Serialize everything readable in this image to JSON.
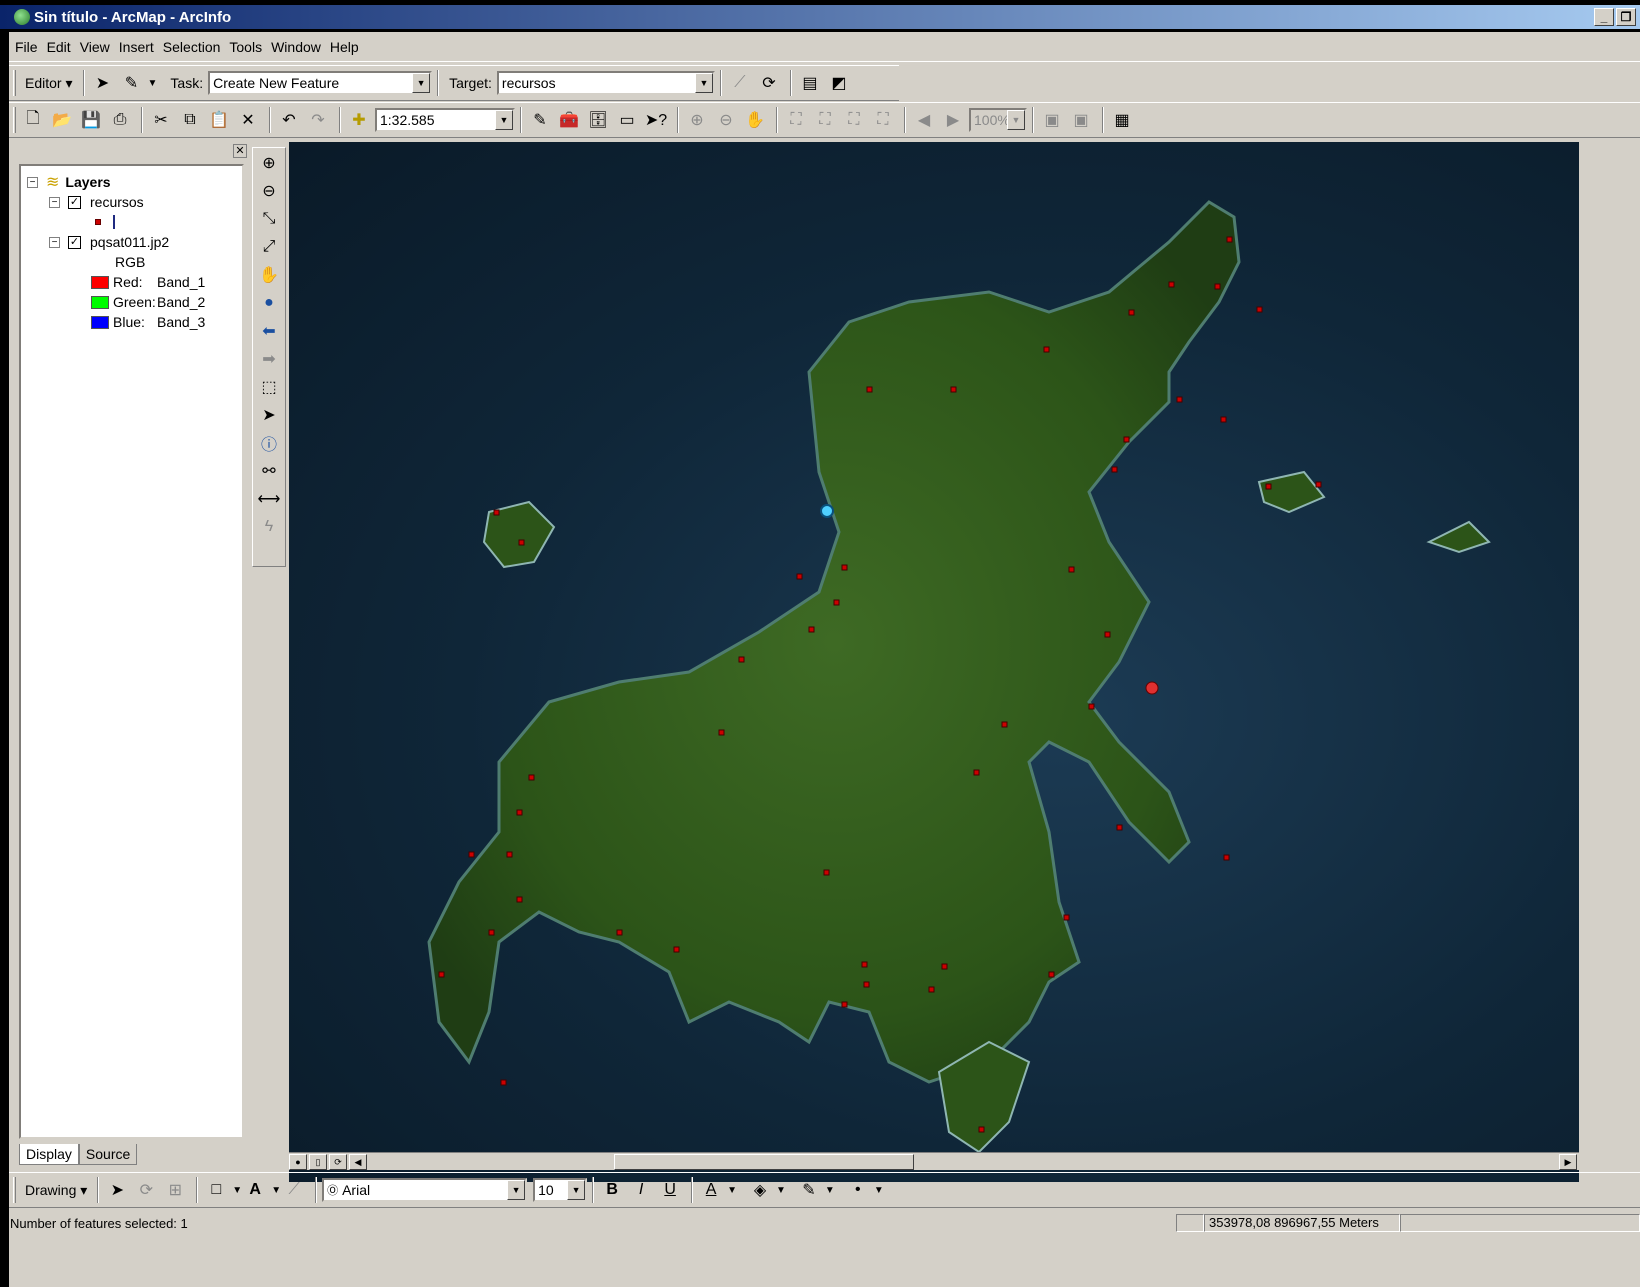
{
  "window": {
    "title": "Sin título - ArcMap - ArcInfo"
  },
  "menu": [
    "File",
    "Edit",
    "View",
    "Insert",
    "Selection",
    "Tools",
    "Window",
    "Help"
  ],
  "editor_toolbar": {
    "editor_label": "Editor",
    "task_label": "Task:",
    "task_value": "Create New Feature",
    "target_label": "Target:",
    "target_value": "recursos"
  },
  "standard_toolbar": {
    "scale": "1:32.585",
    "zoom": "100%"
  },
  "toc": {
    "root": "Layers",
    "layers": [
      {
        "name": "recursos",
        "checked": true
      },
      {
        "name": "pqsat011.jp2",
        "checked": true,
        "composite": "RGB",
        "bands": [
          {
            "label": "Red:",
            "band": "Band_1",
            "color": "#ff0000"
          },
          {
            "label": "Green:",
            "band": "Band_2",
            "color": "#00ff00"
          },
          {
            "label": "Blue:",
            "band": "Band_3",
            "color": "#0000ff"
          }
        ]
      }
    ],
    "tabs": [
      "Display",
      "Source"
    ]
  },
  "drawing_toolbar": {
    "drawing_label": "Drawing",
    "font": "Arial",
    "font_size": "10"
  },
  "status": {
    "message": "Number of features selected: 1",
    "coordinates": "353978,08  896967,55 Meters"
  },
  "colors": {
    "point": "#cc0000",
    "selected_point": "#4fd0ff",
    "titlebar": "#0a246a"
  }
}
